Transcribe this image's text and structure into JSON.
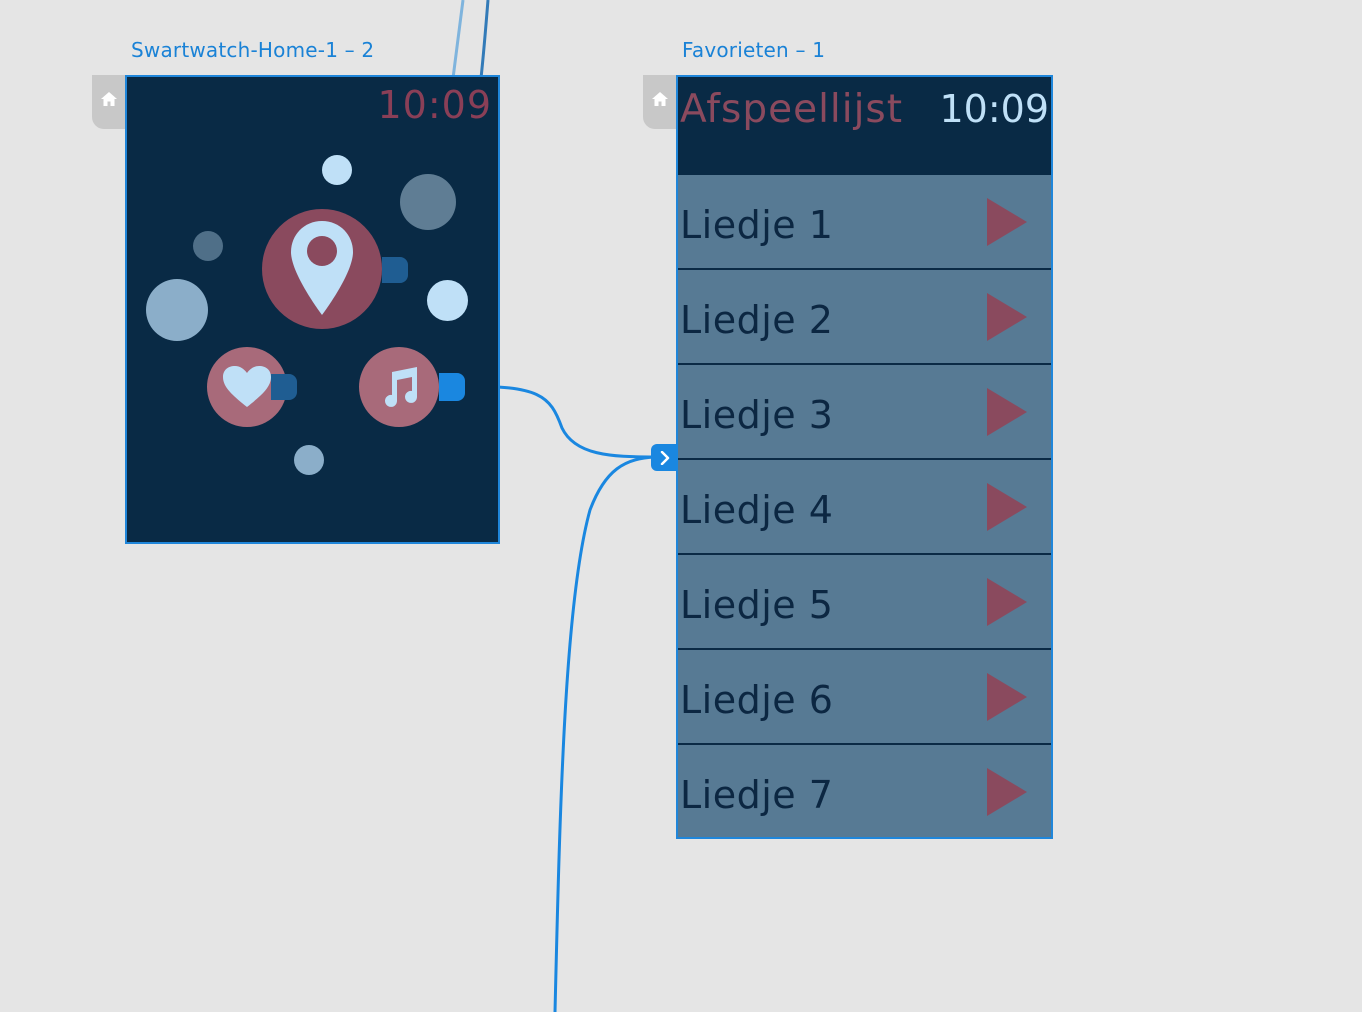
{
  "artboards": {
    "home": {
      "label": "Swartwatch-Home-1 – 2",
      "time": "10:09"
    },
    "favorites": {
      "label": "Favorieten – 1",
      "title": "Afspeellijst",
      "time": "10:09",
      "songs": [
        "Liedje 1",
        "Liedje 2",
        "Liedje 3",
        "Liedje 4",
        "Liedje 5",
        "Liedje 6",
        "Liedje 7"
      ]
    }
  },
  "icons": {
    "home_tab": "home-icon",
    "location": "map-pin-icon",
    "favorites": "heart-icon",
    "music": "music-note-icon",
    "play": "play-icon",
    "connector": "chevron-right-icon"
  },
  "colors": {
    "canvas": "#e5e5e5",
    "watch_bg": "#092a45",
    "accent_red": "#8a4a5e",
    "row_bg": "#577a94",
    "link_blue": "#1a87e0",
    "light_blue": "#bfe0f7"
  }
}
